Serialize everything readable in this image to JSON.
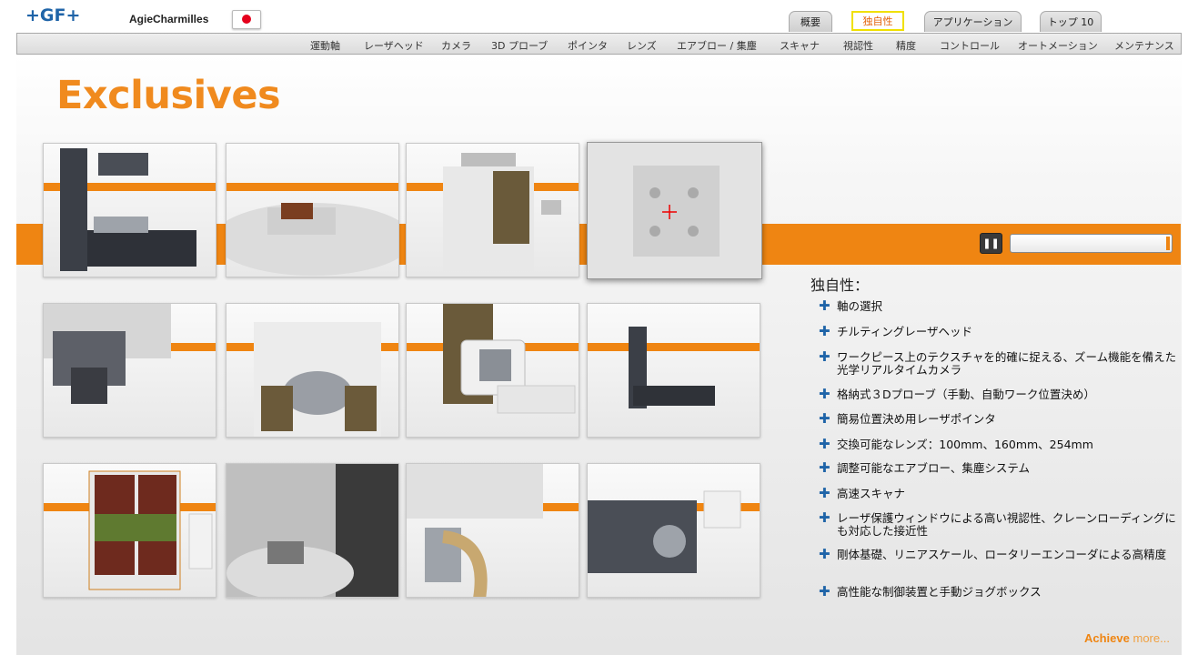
{
  "header": {
    "logo": "+GF+",
    "brand": "AgieCharmilles",
    "tabs": [
      {
        "label": "概要",
        "active": false
      },
      {
        "label": "独自性",
        "active": true
      },
      {
        "label": "アプリケーション",
        "active": false
      },
      {
        "label": "トップ 10",
        "active": false
      }
    ]
  },
  "nav": {
    "items": [
      "運動軸",
      "レーザヘッド",
      "カメラ",
      "3D プローブ",
      "ポインタ",
      "レンズ",
      "エアブロー / 集塵",
      "スキャナ",
      "視認性",
      "精度",
      "コントロール",
      "オートメーション",
      "メンテナンス"
    ]
  },
  "page_title": "Exclusives",
  "gallery": {
    "thumbnails": [
      {
        "name": "machine-axes"
      },
      {
        "name": "workpiece-table"
      },
      {
        "name": "machine-cabin"
      },
      {
        "name": "rotary-table-top"
      },
      {
        "name": "laser-head"
      },
      {
        "name": "machine-open"
      },
      {
        "name": "control-panel"
      },
      {
        "name": "machine-base"
      },
      {
        "name": "protective-window"
      },
      {
        "name": "rotary-table-interior"
      },
      {
        "name": "exhaust-hose"
      },
      {
        "name": "head-components"
      }
    ]
  },
  "slideshow": {
    "pause_icon": "pause-icon",
    "progress": 1.0
  },
  "features": {
    "heading": "独自性：",
    "items": [
      "軸の選択",
      "チルティングレーザヘッド",
      "ワークピース上のテクスチャを的確に捉える、ズーム機能を備えた光学リアルタイムカメラ",
      "格納式３Dプローブ（手動、自動ワーク位置決め）",
      "簡易位置決め用レーザポインタ",
      "交換可能なレンズ：100mm、160mm、254mm",
      "調整可能なエアブロー、集塵システム",
      "高速スキャナ",
      "レーザ保護ウィンドウによる高い視認性、クレーンローディングにも対応した接近性",
      "剛体基礎、リニアスケール、ロータリーエンコーダによる高精度",
      "高性能な制御装置と手動ジョグボックス"
    ]
  },
  "achieve": {
    "word": "Achieve",
    "more": "more..."
  },
  "colors": {
    "accent": "#ef8512",
    "brand_blue": "#1f64a8",
    "active_tab_border": "#f0e000"
  }
}
